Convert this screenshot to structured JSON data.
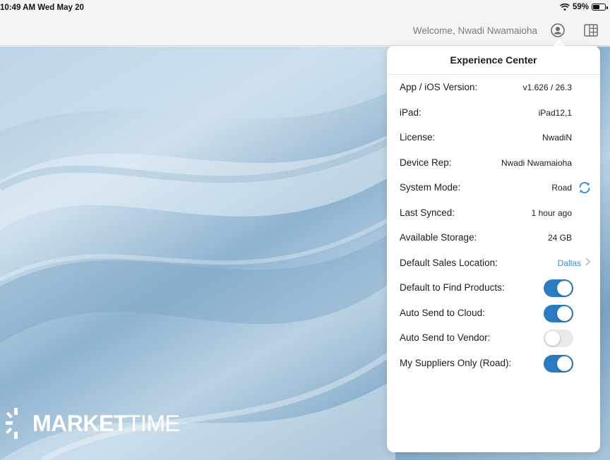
{
  "status_bar": {
    "time": "10:49 AM  Wed May 20",
    "battery": "59%",
    "battery_level": 0.59
  },
  "nav": {
    "welcome": "Welcome, Nwadi Nwamaioha",
    "icons": [
      "user-circle-icon",
      "grid-layout-icon"
    ]
  },
  "brand": {
    "logo_bold": "MARKET",
    "logo_light": "TIME"
  },
  "popover": {
    "title": "Experience Center",
    "rows": [
      {
        "label": "App / iOS Version:",
        "value": "v1.626 / 26.3"
      },
      {
        "label": "iPad:",
        "value": "iPad12,1"
      },
      {
        "label": "License:",
        "value": "NwadiN"
      },
      {
        "label": "Device Rep:",
        "value": "Nwadi Nwamaioha"
      },
      {
        "label": "System Mode:",
        "value": "Road"
      },
      {
        "label": "Last Synced:",
        "value": "1 hour ago"
      },
      {
        "label": "Available Storage:",
        "value": "24 GB"
      },
      {
        "label": "Default Sales Location:",
        "value": "Dallas"
      },
      {
        "label": "Default to Find Products:",
        "on": true
      },
      {
        "label": "Auto Send to Cloud:",
        "on": true
      },
      {
        "label": "Auto Send to Vendor:",
        "on": false
      },
      {
        "label": "My Suppliers Only (Road):",
        "on": true
      }
    ]
  },
  "colors": {
    "accent": "#2b7bc2",
    "link": "#2f8de4"
  }
}
